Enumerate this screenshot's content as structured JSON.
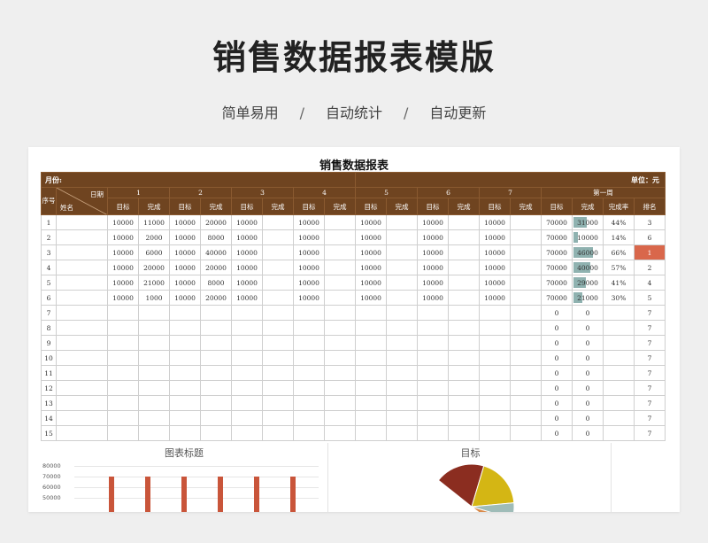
{
  "hero": {
    "title": "销售数据报表模版",
    "features": [
      "简单易用",
      "自动统计",
      "自动更新"
    ],
    "separator": "/"
  },
  "sheet": {
    "title": "销售数据报表",
    "month_label": "月份:",
    "unit_label": "单位：元",
    "col_seq": "序号",
    "diag_top": "日期",
    "diag_bottom": "姓名",
    "days": [
      "1",
      "2",
      "3",
      "4",
      "5",
      "6",
      "7"
    ],
    "week_label": "第一周",
    "sub_target": "目标",
    "sub_done": "完成",
    "sub_rate": "完成率",
    "sub_rank": "排名",
    "rows": [
      {
        "seq": "1",
        "days": [
          [
            "10000",
            "11000"
          ],
          [
            "10000",
            "20000"
          ],
          [
            "10000",
            ""
          ],
          [
            "10000",
            ""
          ],
          [
            "10000",
            ""
          ],
          [
            "10000",
            ""
          ],
          [
            "10000",
            ""
          ]
        ],
        "target": "70000",
        "done": "31000",
        "done_frac": 0.44,
        "rate": "44%",
        "rank": "3",
        "hot": false
      },
      {
        "seq": "2",
        "days": [
          [
            "10000",
            "2000"
          ],
          [
            "10000",
            "8000"
          ],
          [
            "10000",
            ""
          ],
          [
            "10000",
            ""
          ],
          [
            "10000",
            ""
          ],
          [
            "10000",
            ""
          ],
          [
            "10000",
            ""
          ]
        ],
        "target": "70000",
        "done": "10000",
        "done_frac": 0.14,
        "rate": "14%",
        "rank": "6",
        "hot": false
      },
      {
        "seq": "3",
        "days": [
          [
            "10000",
            "6000"
          ],
          [
            "10000",
            "40000"
          ],
          [
            "10000",
            ""
          ],
          [
            "10000",
            ""
          ],
          [
            "10000",
            ""
          ],
          [
            "10000",
            ""
          ],
          [
            "10000",
            ""
          ]
        ],
        "target": "70000",
        "done": "46000",
        "done_frac": 0.66,
        "rate": "66%",
        "rank": "1",
        "hot": true
      },
      {
        "seq": "4",
        "days": [
          [
            "10000",
            "20000"
          ],
          [
            "10000",
            "20000"
          ],
          [
            "10000",
            ""
          ],
          [
            "10000",
            ""
          ],
          [
            "10000",
            ""
          ],
          [
            "10000",
            ""
          ],
          [
            "10000",
            ""
          ]
        ],
        "target": "70000",
        "done": "40000",
        "done_frac": 0.57,
        "rate": "57%",
        "rank": "2",
        "hot": false
      },
      {
        "seq": "5",
        "days": [
          [
            "10000",
            "21000"
          ],
          [
            "10000",
            "8000"
          ],
          [
            "10000",
            ""
          ],
          [
            "10000",
            ""
          ],
          [
            "10000",
            ""
          ],
          [
            "10000",
            ""
          ],
          [
            "10000",
            ""
          ]
        ],
        "target": "70000",
        "done": "29000",
        "done_frac": 0.41,
        "rate": "41%",
        "rank": "4",
        "hot": false
      },
      {
        "seq": "6",
        "days": [
          [
            "10000",
            "1000"
          ],
          [
            "10000",
            "20000"
          ],
          [
            "10000",
            ""
          ],
          [
            "10000",
            ""
          ],
          [
            "10000",
            ""
          ],
          [
            "10000",
            ""
          ],
          [
            "10000",
            ""
          ]
        ],
        "target": "70000",
        "done": "21000",
        "done_frac": 0.3,
        "rate": "30%",
        "rank": "5",
        "hot": false
      },
      {
        "seq": "7",
        "days": [
          [
            "",
            ""
          ],
          [
            "",
            ""
          ],
          [
            "",
            ""
          ],
          [
            "",
            ""
          ],
          [
            "",
            ""
          ],
          [
            "",
            ""
          ],
          [
            "",
            ""
          ]
        ],
        "target": "0",
        "done": "0",
        "done_frac": 0,
        "rate": "",
        "rank": "7",
        "hot": false
      },
      {
        "seq": "8",
        "days": [
          [
            "",
            ""
          ],
          [
            "",
            ""
          ],
          [
            "",
            ""
          ],
          [
            "",
            ""
          ],
          [
            "",
            ""
          ],
          [
            "",
            ""
          ],
          [
            "",
            ""
          ]
        ],
        "target": "0",
        "done": "0",
        "done_frac": 0,
        "rate": "",
        "rank": "7",
        "hot": false
      },
      {
        "seq": "9",
        "days": [
          [
            "",
            ""
          ],
          [
            "",
            ""
          ],
          [
            "",
            ""
          ],
          [
            "",
            ""
          ],
          [
            "",
            ""
          ],
          [
            "",
            ""
          ],
          [
            "",
            ""
          ]
        ],
        "target": "0",
        "done": "0",
        "done_frac": 0,
        "rate": "",
        "rank": "7",
        "hot": false
      },
      {
        "seq": "10",
        "days": [
          [
            "",
            ""
          ],
          [
            "",
            ""
          ],
          [
            "",
            ""
          ],
          [
            "",
            ""
          ],
          [
            "",
            ""
          ],
          [
            "",
            ""
          ],
          [
            "",
            ""
          ]
        ],
        "target": "0",
        "done": "0",
        "done_frac": 0,
        "rate": "",
        "rank": "7",
        "hot": false
      },
      {
        "seq": "11",
        "days": [
          [
            "",
            ""
          ],
          [
            "",
            ""
          ],
          [
            "",
            ""
          ],
          [
            "",
            ""
          ],
          [
            "",
            ""
          ],
          [
            "",
            ""
          ],
          [
            "",
            ""
          ]
        ],
        "target": "0",
        "done": "0",
        "done_frac": 0,
        "rate": "",
        "rank": "7",
        "hot": false
      },
      {
        "seq": "12",
        "days": [
          [
            "",
            ""
          ],
          [
            "",
            ""
          ],
          [
            "",
            ""
          ],
          [
            "",
            ""
          ],
          [
            "",
            ""
          ],
          [
            "",
            ""
          ],
          [
            "",
            ""
          ]
        ],
        "target": "0",
        "done": "0",
        "done_frac": 0,
        "rate": "",
        "rank": "7",
        "hot": false
      },
      {
        "seq": "13",
        "days": [
          [
            "",
            ""
          ],
          [
            "",
            ""
          ],
          [
            "",
            ""
          ],
          [
            "",
            ""
          ],
          [
            "",
            ""
          ],
          [
            "",
            ""
          ],
          [
            "",
            ""
          ]
        ],
        "target": "0",
        "done": "0",
        "done_frac": 0,
        "rate": "",
        "rank": "7",
        "hot": false
      },
      {
        "seq": "14",
        "days": [
          [
            "",
            ""
          ],
          [
            "",
            ""
          ],
          [
            "",
            ""
          ],
          [
            "",
            ""
          ],
          [
            "",
            ""
          ],
          [
            "",
            ""
          ],
          [
            "",
            ""
          ]
        ],
        "target": "0",
        "done": "0",
        "done_frac": 0,
        "rate": "",
        "rank": "7",
        "hot": false
      },
      {
        "seq": "15",
        "days": [
          [
            "",
            ""
          ],
          [
            "",
            ""
          ],
          [
            "",
            ""
          ],
          [
            "",
            ""
          ],
          [
            "",
            ""
          ],
          [
            "",
            ""
          ],
          [
            "",
            ""
          ]
        ],
        "target": "0",
        "done": "0",
        "done_frac": 0,
        "rate": "",
        "rank": "7",
        "hot": false
      }
    ]
  },
  "colors": {
    "header_brown": "#6f4420",
    "bar_teal": "#8fb2b0",
    "rank_hot": "#d9674b",
    "bar_red": "#c9553a"
  },
  "chart_data": [
    {
      "type": "bar",
      "title": "图表标题",
      "y_ticks": [
        "80000",
        "70000",
        "60000",
        "50000"
      ],
      "ylim": [
        50000,
        80000
      ],
      "values": [
        70000,
        70000,
        70000,
        70000,
        70000,
        70000
      ]
    },
    {
      "type": "pie",
      "title": "目标",
      "slices": [
        {
          "value": 25,
          "color": "#8b2d20"
        },
        {
          "value": 25,
          "color": "#d4b614"
        },
        {
          "value": 8,
          "color": "#9fbcb8"
        },
        {
          "value": 8,
          "color": "#d98a4a"
        }
      ]
    }
  ]
}
